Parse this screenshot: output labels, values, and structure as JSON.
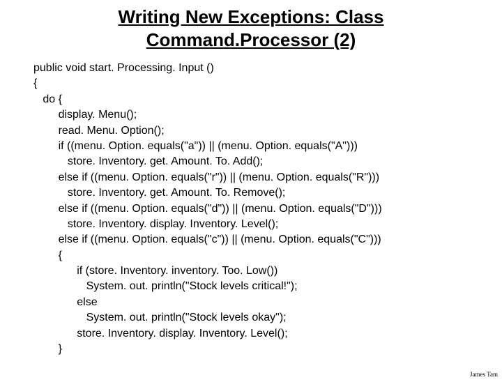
{
  "title_line1": "Writing New Exceptions: Class",
  "title_line2": "Command.Processor (2)",
  "code": {
    "l1": "public void start. Processing. Input ()",
    "l2": "{",
    "l3": "   do {",
    "l4": "        display. Menu();",
    "l5": "        read. Menu. Option();",
    "l6": "        if ((menu. Option. equals(\"a\")) || (menu. Option. equals(\"A\")))",
    "l7": "           store. Inventory. get. Amount. To. Add();",
    "l8": "        else if ((menu. Option. equals(\"r\")) || (menu. Option. equals(\"R\")))",
    "l9": "           store. Inventory. get. Amount. To. Remove();",
    "l10": "        else if ((menu. Option. equals(\"d\")) || (menu. Option. equals(\"D\")))",
    "l11": "           store. Inventory. display. Inventory. Level();",
    "l12": "        else if ((menu. Option. equals(\"c\")) || (menu. Option. equals(\"C\")))",
    "l13": "        {",
    "l14": "              if (store. Inventory. inventory. Too. Low())",
    "l15": "                 System. out. println(\"Stock levels critical!\");",
    "l16": "              else",
    "l17": "                 System. out. println(\"Stock levels okay\");",
    "l18": "              store. Inventory. display. Inventory. Level();",
    "l19": "        }"
  },
  "footer": "James Tam"
}
